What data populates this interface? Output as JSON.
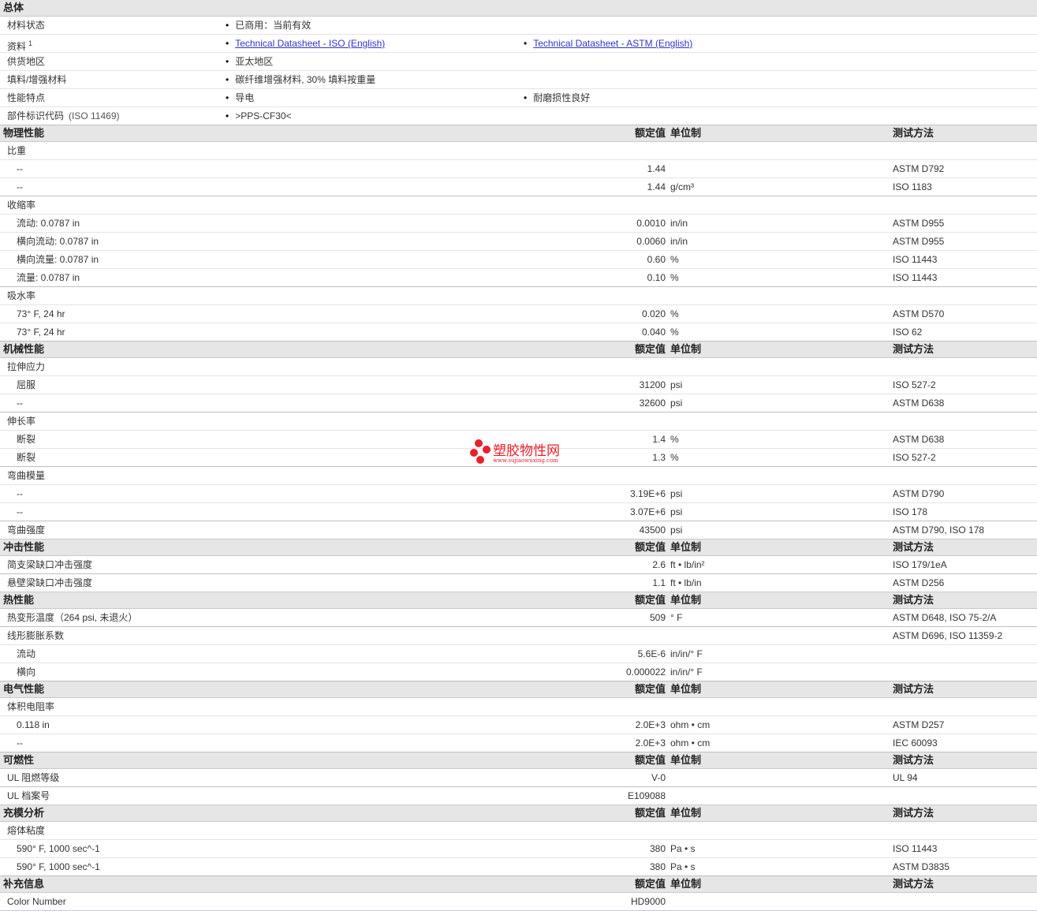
{
  "general": {
    "title": "总体",
    "rows": [
      {
        "label": "材料状态",
        "v1": "已商用：当前有效"
      },
      {
        "label": "资料",
        "sup": "1",
        "v1": "Technical Datasheet - ISO (English)",
        "v2": "Technical Datasheet - ASTM (English)",
        "links": true
      },
      {
        "label": "供货地区",
        "v1": "亚太地区"
      },
      {
        "label": "填料/增强材料",
        "v1": "碳纤维增强材料, 30% 填料按重量"
      },
      {
        "label": "性能特点",
        "v1": "导电",
        "v2": "耐磨损性良好"
      },
      {
        "label": "部件标识代码",
        "note": "(ISO 11469)",
        "v1": ">PPS-CF30<"
      }
    ]
  },
  "headers": {
    "value": "额定值",
    "unit": "单位制",
    "method": "测试方法"
  },
  "sections": [
    {
      "title": "物理性能",
      "groups": [
        {
          "label": "比重",
          "items": [
            {
              "label": "--",
              "value": "1.44",
              "unit": "",
              "method": "ASTM D792"
            },
            {
              "label": "--",
              "value": "1.44",
              "unit": "g/cm³",
              "method": "ISO 1183"
            }
          ]
        },
        {
          "label": "收缩率",
          "items": [
            {
              "label": "流动: 0.0787 in",
              "value": "0.0010",
              "unit": "in/in",
              "method": "ASTM D955"
            },
            {
              "label": "横向流动: 0.0787 in",
              "value": "0.0060",
              "unit": "in/in",
              "method": "ASTM D955"
            },
            {
              "label": "横向流量: 0.0787 in",
              "value": "0.60",
              "unit": "%",
              "method": "ISO 11443"
            },
            {
              "label": "流量: 0.0787 in",
              "value": "0.10",
              "unit": "%",
              "method": "ISO 11443"
            }
          ]
        },
        {
          "label": "吸水率",
          "items": [
            {
              "label": "73° F, 24 hr",
              "value": "0.020",
              "unit": "%",
              "method": "ASTM D570"
            },
            {
              "label": "73° F, 24 hr",
              "value": "0.040",
              "unit": "%",
              "method": "ISO 62"
            }
          ]
        }
      ]
    },
    {
      "title": "机械性能",
      "groups": [
        {
          "label": "拉伸应力",
          "items": [
            {
              "label": "屈服",
              "value": "31200",
              "unit": "psi",
              "method": "ISO 527-2"
            },
            {
              "label": "--",
              "value": "32600",
              "unit": "psi",
              "method": "ASTM D638"
            }
          ]
        },
        {
          "label": "伸长率",
          "items": [
            {
              "label": "断裂",
              "value": "1.4",
              "unit": "%",
              "method": "ASTM D638"
            },
            {
              "label": "断裂",
              "value": "1.3",
              "unit": "%",
              "method": "ISO 527-2"
            }
          ]
        },
        {
          "label": "弯曲模量",
          "items": [
            {
              "label": "--",
              "value": "3.19E+6",
              "unit": "psi",
              "method": "ASTM D790"
            },
            {
              "label": "--",
              "value": "3.07E+6",
              "unit": "psi",
              "method": "ISO 178"
            }
          ]
        },
        {
          "label": "弯曲强度",
          "value": "43500",
          "unit": "psi",
          "method": "ASTM D790, ISO 178",
          "items": []
        }
      ]
    },
    {
      "title": "冲击性能",
      "groups": [
        {
          "label": "简支梁缺口冲击强度",
          "value": "2.6",
          "unit": "ft • lb/in²",
          "method": "ISO 179/1eA",
          "items": []
        },
        {
          "label": "悬壁梁缺口冲击强度",
          "value": "1.1",
          "unit": "ft • lb/in",
          "method": "ASTM D256",
          "items": []
        }
      ]
    },
    {
      "title": "热性能",
      "groups": [
        {
          "label": "热变形温度（264 psi, 未退火）",
          "value": "509",
          "unit": "° F",
          "method": "ASTM D648, ISO 75-2/A",
          "items": []
        },
        {
          "label": "线形膨胀系数",
          "method": "ASTM D696, ISO 11359-2",
          "items": [
            {
              "label": "流动",
              "value": "5.6E-6",
              "unit": "in/in/° F",
              "method": ""
            },
            {
              "label": "横向",
              "value": "0.000022",
              "unit": "in/in/° F",
              "method": ""
            }
          ]
        }
      ]
    },
    {
      "title": "电气性能",
      "groups": [
        {
          "label": "体积电阻率",
          "items": [
            {
              "label": "0.118 in",
              "value": "2.0E+3",
              "unit": "ohm • cm",
              "method": "ASTM D257"
            },
            {
              "label": "--",
              "value": "2.0E+3",
              "unit": "ohm • cm",
              "method": "IEC 60093"
            }
          ]
        }
      ]
    },
    {
      "title": "可燃性",
      "groups": [
        {
          "label": "UL 阻燃等级",
          "value": "V-0",
          "unit": "",
          "method": "UL 94",
          "items": []
        },
        {
          "label": "UL 档案号",
          "value": "E109088",
          "unit": "",
          "method": "",
          "items": []
        }
      ]
    },
    {
      "title": "充模分析",
      "groups": [
        {
          "label": "熔体粘度",
          "items": [
            {
              "label": "590° F, 1000 sec^-1",
              "value": "380",
              "unit": "Pa • s",
              "method": "ISO 11443"
            },
            {
              "label": "590° F, 1000 sec^-1",
              "value": "380",
              "unit": "Pa • s",
              "method": "ASTM D3835"
            }
          ]
        }
      ]
    },
    {
      "title": "补充信息",
      "groups": [
        {
          "label": "Color Number",
          "value": "HD9000",
          "unit": "",
          "method": "",
          "items": []
        }
      ]
    }
  ],
  "watermark": {
    "name": "塑胶物性网",
    "url": "www.sujiaowuxing.com",
    "color": "#e8202a"
  }
}
